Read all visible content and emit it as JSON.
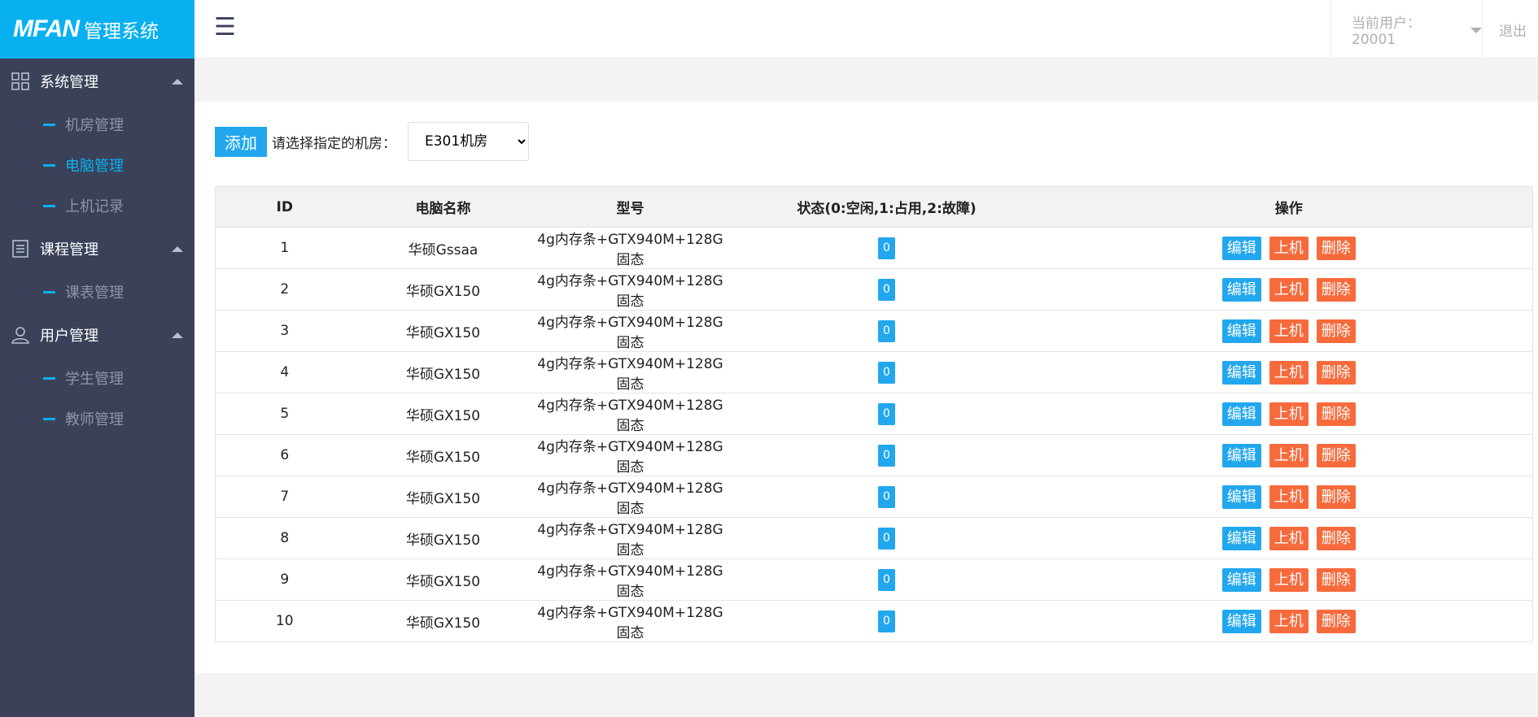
{
  "logo": {
    "brand": "MFAN",
    "subtitle": "管理系统"
  },
  "colors": {
    "accent": "#09b0f0",
    "sidebar_bg": "#3a4159",
    "button_blue": "#22a7ee",
    "button_orange": "#f76a3c"
  },
  "sidebar": {
    "groups": [
      {
        "label": "系统管理",
        "icon": "grid-icon",
        "items": [
          {
            "label": "机房管理"
          },
          {
            "label": "电脑管理",
            "active": true
          },
          {
            "label": "上机记录"
          }
        ]
      },
      {
        "label": "课程管理",
        "icon": "document-icon",
        "items": [
          {
            "label": "课表管理"
          }
        ]
      },
      {
        "label": "用户管理",
        "icon": "user-icon",
        "items": [
          {
            "label": "学生管理"
          },
          {
            "label": "教师管理"
          }
        ]
      }
    ]
  },
  "header": {
    "menu_icon": "hamburger-icon",
    "current_user": "当前用户：20001",
    "logout": "退出"
  },
  "toolbar": {
    "add_label": "添加",
    "select_label": "请选择指定的机房：",
    "room_options": [
      "E301机房"
    ],
    "selected_room": "E301机房"
  },
  "table": {
    "columns": [
      "ID",
      "电脑名称",
      "型号",
      "状态(0:空闲,1:占用,2:故障)",
      "操作"
    ],
    "rows": [
      {
        "id": "1",
        "name": "华硕Gssaa",
        "model": "4g内存条+GTX940M+128G固态",
        "status": "0"
      },
      {
        "id": "2",
        "name": "华硕GX150",
        "model": "4g内存条+GTX940M+128G固态",
        "status": "0"
      },
      {
        "id": "3",
        "name": "华硕GX150",
        "model": "4g内存条+GTX940M+128G固态",
        "status": "0"
      },
      {
        "id": "4",
        "name": "华硕GX150",
        "model": "4g内存条+GTX940M+128G固态",
        "status": "0"
      },
      {
        "id": "5",
        "name": "华硕GX150",
        "model": "4g内存条+GTX940M+128G固态",
        "status": "0"
      },
      {
        "id": "6",
        "name": "华硕GX150",
        "model": "4g内存条+GTX940M+128G固态",
        "status": "0"
      },
      {
        "id": "7",
        "name": "华硕GX150",
        "model": "4g内存条+GTX940M+128G固态",
        "status": "0"
      },
      {
        "id": "8",
        "name": "华硕GX150",
        "model": "4g内存条+GTX940M+128G固态",
        "status": "0"
      },
      {
        "id": "9",
        "name": "华硕GX150",
        "model": "4g内存条+GTX940M+128G固态",
        "status": "0"
      },
      {
        "id": "10",
        "name": "华硕GX150",
        "model": "4g内存条+GTX940M+128G固态",
        "status": "0"
      }
    ],
    "actions": {
      "edit": "编辑",
      "online": "上机",
      "delete": "删除"
    }
  }
}
